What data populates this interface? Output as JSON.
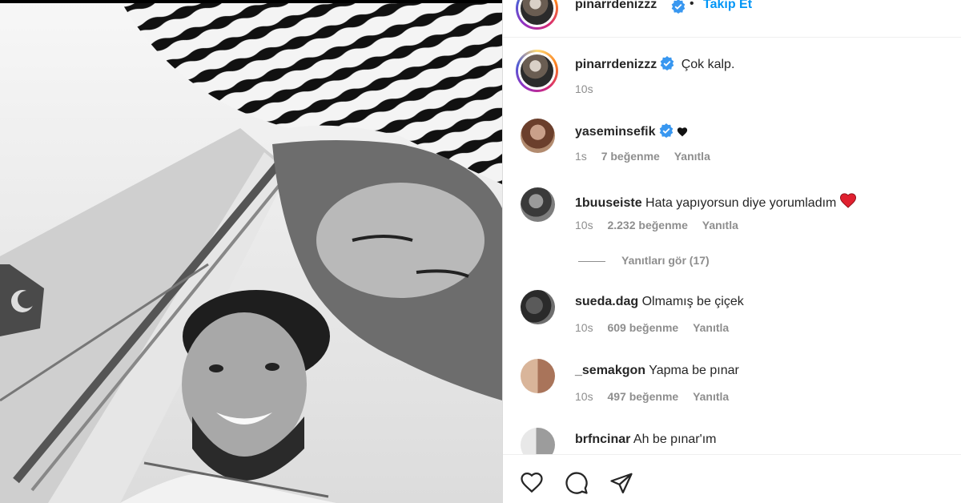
{
  "post": {
    "username": "pinarrdenizzz",
    "follow_label": "Takip Et",
    "separator": "•"
  },
  "caption": {
    "username": "pinarrdenizzz",
    "text": "Çok kalp.",
    "time": "10s"
  },
  "comments": [
    {
      "username": "yaseminsefik",
      "verified": true,
      "text": "",
      "emoji": "black-heart",
      "time": "1s",
      "likes": "7 beğenme",
      "reply_label": "Yanıtla"
    },
    {
      "username": "1buuseiste",
      "verified": false,
      "text": "Hata yapıyorsun diye yorumladım",
      "emoji": "red-heart",
      "time": "10s",
      "likes": "2.232 beğenme",
      "reply_label": "Yanıtla"
    },
    {
      "username": "sueda.dag",
      "verified": false,
      "text": "Olmamış be çiçek",
      "time": "10s",
      "likes": "609 beğenme",
      "reply_label": "Yanıtla"
    },
    {
      "username": "_semakgon",
      "verified": false,
      "text": "Yapma be pınar",
      "time": "10s",
      "likes": "497 beğenme",
      "reply_label": "Yanıtla"
    },
    {
      "username": "brfncinar",
      "verified": false,
      "text": "Ah be pınar'ım"
    }
  ],
  "view_replies_label": "Yanıtları gör (17)",
  "icons": {
    "verified": "verified-badge-icon",
    "like": "heart-icon",
    "comment": "comment-bubble-icon",
    "share": "paper-plane-icon"
  },
  "colors": {
    "link_blue": "#0095f6",
    "verified_blue": "#3897f0",
    "meta_gray": "#8e8e8e",
    "text": "#262626",
    "heart_red": "#ed4956"
  }
}
